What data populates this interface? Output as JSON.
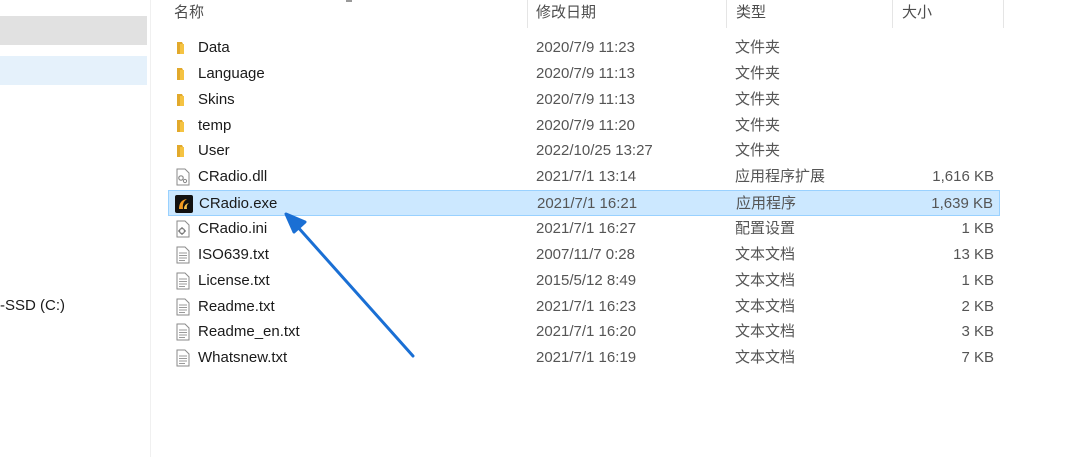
{
  "nav": {
    "drive_label": "-SSD (C:)"
  },
  "columns": {
    "name": "名称",
    "date": "修改日期",
    "type": "类型",
    "size": "大小"
  },
  "files": [
    {
      "name": "Data",
      "date": "2020/7/9 11:23",
      "type": "文件夹",
      "size": "",
      "icon": "folder-icon"
    },
    {
      "name": "Language",
      "date": "2020/7/9 11:13",
      "type": "文件夹",
      "size": "",
      "icon": "folder-icon"
    },
    {
      "name": "Skins",
      "date": "2020/7/9 11:13",
      "type": "文件夹",
      "size": "",
      "icon": "folder-icon"
    },
    {
      "name": "temp",
      "date": "2020/7/9 11:20",
      "type": "文件夹",
      "size": "",
      "icon": "folder-icon"
    },
    {
      "name": "User",
      "date": "2022/10/25 13:27",
      "type": "文件夹",
      "size": "",
      "icon": "folder-icon"
    },
    {
      "name": "CRadio.dll",
      "date": "2021/7/1 13:14",
      "type": "应用程序扩展",
      "size": "1,616 KB",
      "icon": "dll-file-icon"
    },
    {
      "name": "CRadio.exe",
      "date": "2021/7/1 16:21",
      "type": "应用程序",
      "size": "1,639 KB",
      "icon": "app-exe-icon",
      "selected": true
    },
    {
      "name": "CRadio.ini",
      "date": "2021/7/1 16:27",
      "type": "配置设置",
      "size": "1 KB",
      "icon": "ini-file-icon"
    },
    {
      "name": "ISO639.txt",
      "date": "2007/11/7 0:28",
      "type": "文本文档",
      "size": "13 KB",
      "icon": "text-file-icon"
    },
    {
      "name": "License.txt",
      "date": "2015/5/12 8:49",
      "type": "文本文档",
      "size": "1 KB",
      "icon": "text-file-icon"
    },
    {
      "name": "Readme.txt",
      "date": "2021/7/1 16:23",
      "type": "文本文档",
      "size": "2 KB",
      "icon": "text-file-icon"
    },
    {
      "name": "Readme_en.txt",
      "date": "2021/7/1 16:20",
      "type": "文本文档",
      "size": "3 KB",
      "icon": "text-file-icon"
    },
    {
      "name": "Whatsnew.txt",
      "date": "2021/7/1 16:19",
      "type": "文本文档",
      "size": "7 KB",
      "icon": "text-file-icon"
    }
  ],
  "colors": {
    "selection_bg": "#cce8ff",
    "selection_border": "#99d1ff",
    "folder": "#f5c342",
    "arrow": "#1a6fd4"
  }
}
